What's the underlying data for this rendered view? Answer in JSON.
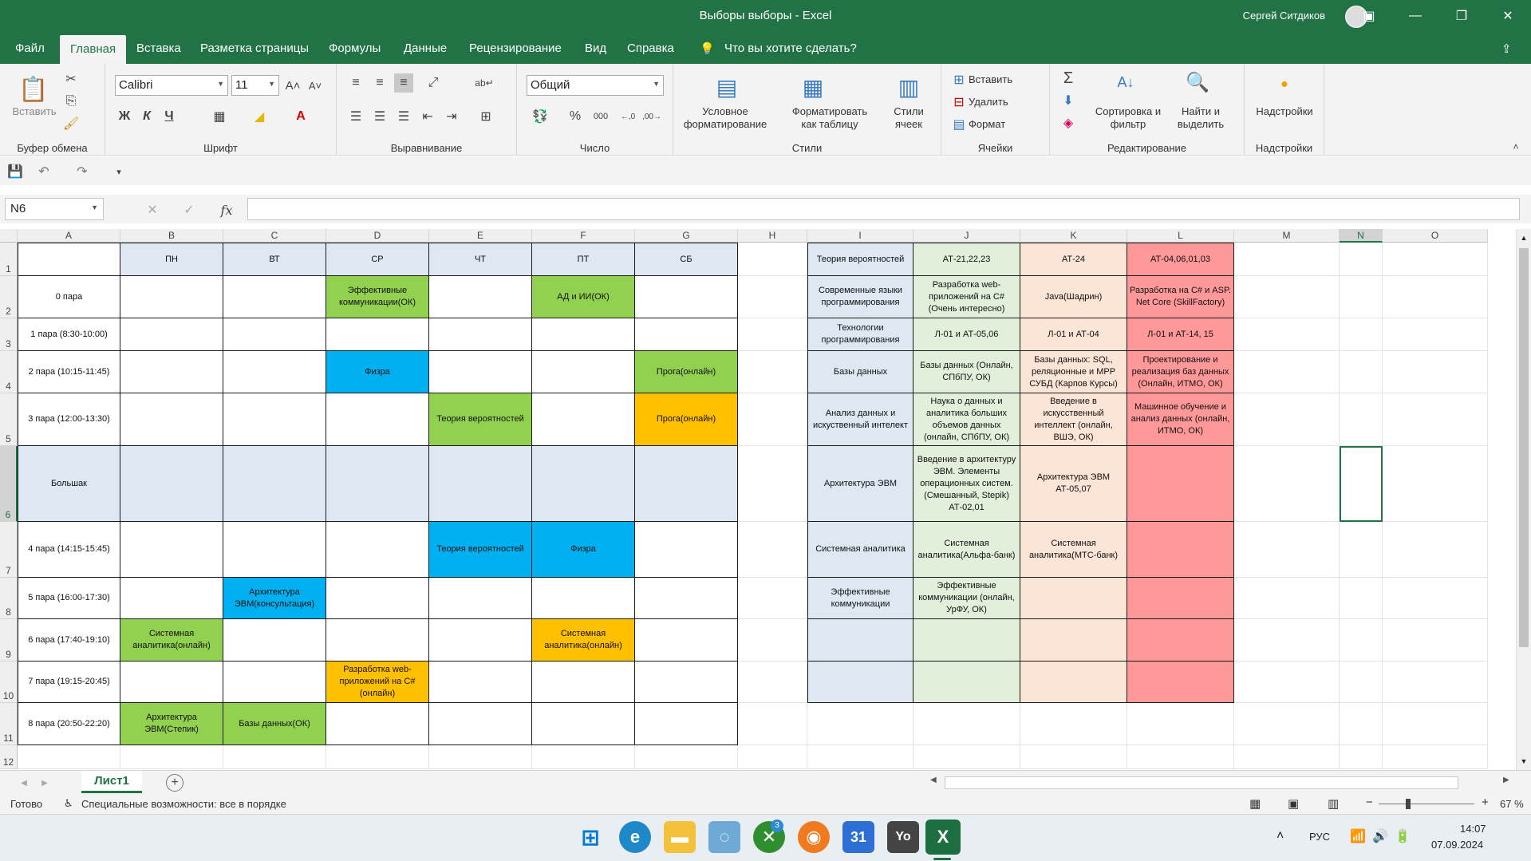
{
  "window": {
    "title": "Выборы выборы  -  Excel",
    "user": "Сергей Ситдиков"
  },
  "menu": {
    "file": "Файл",
    "home": "Главная",
    "insert": "Вставка",
    "page_layout": "Разметка страницы",
    "formulas": "Формулы",
    "data": "Данные",
    "review": "Рецензирование",
    "view": "Вид",
    "help": "Справка",
    "tell_me": "Что вы хотите сделать?"
  },
  "ribbon": {
    "clipboard": {
      "label": "Буфер обмена",
      "paste": "Вставить"
    },
    "font": {
      "label": "Шрифт",
      "name": "Calibri",
      "size": "11",
      "bold": "Ж",
      "italic": "К",
      "underline": "Ч"
    },
    "alignment": {
      "label": "Выравнивание"
    },
    "number": {
      "label": "Число",
      "format": "Общий"
    },
    "styles": {
      "label": "Стили",
      "conditional": "Условное форматирование",
      "as_table": "Форматировать как таблицу",
      "cell_styles": "Стили ячеек"
    },
    "cells": {
      "label": "Ячейки",
      "insert": "Вставить",
      "delete": "Удалить",
      "format": "Формат"
    },
    "editing": {
      "label": "Редактирование",
      "sort": "Сортировка и фильтр",
      "find": "Найти и выделить"
    },
    "addins": {
      "label": "Надстройки",
      "button": "Надстройки"
    }
  },
  "formula_bar": {
    "name_box": "N6",
    "fx": "fx",
    "value": ""
  },
  "columns": [
    "A",
    "B",
    "C",
    "D",
    "E",
    "F",
    "G",
    "H",
    "I",
    "J",
    "K",
    "L",
    "M",
    "N",
    "O"
  ],
  "rows": [
    "1",
    "2",
    "3",
    "4",
    "5",
    "6",
    "7",
    "8",
    "9",
    "10",
    "11",
    "12"
  ],
  "schedule": {
    "days": [
      "ПН",
      "ВТ",
      "СР",
      "ЧТ",
      "ПТ",
      "СБ"
    ],
    "slots": [
      "0 пара",
      "1 пара (8:30-10:00)",
      "2 пара (10:15-11:45)",
      "3 пара (12:00-13:30)",
      "Большак",
      "4 пара (14:15-15:45)",
      "5 пара (16:00-17:30)",
      "6 пара (17:40-19:10)",
      "7 пара (19:15-20:45)",
      "8 пара (20:50-22:20)"
    ],
    "entries": {
      "d2": "Эффективные коммуникации(ОК)",
      "f2": "АД и ИИ(ОК)",
      "d4": "Физра",
      "g4": "Прога(онлайн)",
      "e5": "Теория вероятностей",
      "g5": "Прога(онлайн)",
      "e7": "Теория вероятностей",
      "f7": "Физра",
      "c8": "Архитектура ЭВМ(консультация)",
      "b9": "Системная аналитика(онлайн)",
      "f9": "Системная аналитика(онлайн)",
      "d10": "Разработка web-приложений на C#(онлайн)",
      "b11": "Архитектура ЭВМ(Степик)",
      "c11": "Базы данных(ОК)"
    }
  },
  "electives": {
    "header": [
      "Теория вероятностей",
      "АТ-21,22,23",
      "АТ-24",
      "АТ-04,06,01,03"
    ],
    "rows": [
      [
        "Современные языки программирования",
        "Разработка web-приложений на C#(Очень интересно)",
        "Java(Шадрин)",
        "Разработка на C# и ASP. Net Core (SkillFactory)"
      ],
      [
        "Технологии программирования",
        "Л-01 и АТ-05,06",
        "Л-01 и АТ-04",
        "Л-01 и АТ-14, 15"
      ],
      [
        "Базы данных",
        "Базы данных (Онлайн, СПбПУ, ОК)",
        "Базы данных: SQL, реляционные и MPP СУБД (Карпов Курсы)",
        "Проектирование и реализация баз данных (Онлайн, ИТМО, ОК)"
      ],
      [
        "Анализ данных и искуственный интелект",
        "Наука о данных и аналитика больших объемов данных (онлайн, СПбПУ, ОК)",
        "Введение в искусственный интеллект (онлайн, ВШЭ, ОК)",
        "Машинное обучение и анализ данных (онлайн, ИТМО, ОК)"
      ],
      [
        "Архитектура ЭВМ",
        "Введение в архитектуру ЭВМ. Элементы операционных систем. (Смешанный, Stepik) АТ-02,01",
        "Архитектура ЭВМ АТ-05,07",
        ""
      ],
      [
        "Системная аналитика",
        "Системная аналитика(Альфа-банк)",
        "Системная аналитика(МТС-банк)",
        ""
      ],
      [
        "Эффективные коммуникации",
        "Эффективные коммуникации (онлайн, УрФУ, ОК)",
        "",
        ""
      ],
      [
        "",
        "",
        "",
        ""
      ],
      [
        "",
        "",
        "",
        ""
      ]
    ]
  },
  "sheet": {
    "tab": "Лист1"
  },
  "status": {
    "ready": "Готово",
    "accessibility": "Специальные возможности: все в порядке",
    "zoom": "67 %"
  },
  "taskbar": {
    "lang": "РУС",
    "time": "14:07",
    "date": "07.09.2024",
    "xbox_badge": "3",
    "calendar_day": "31"
  }
}
